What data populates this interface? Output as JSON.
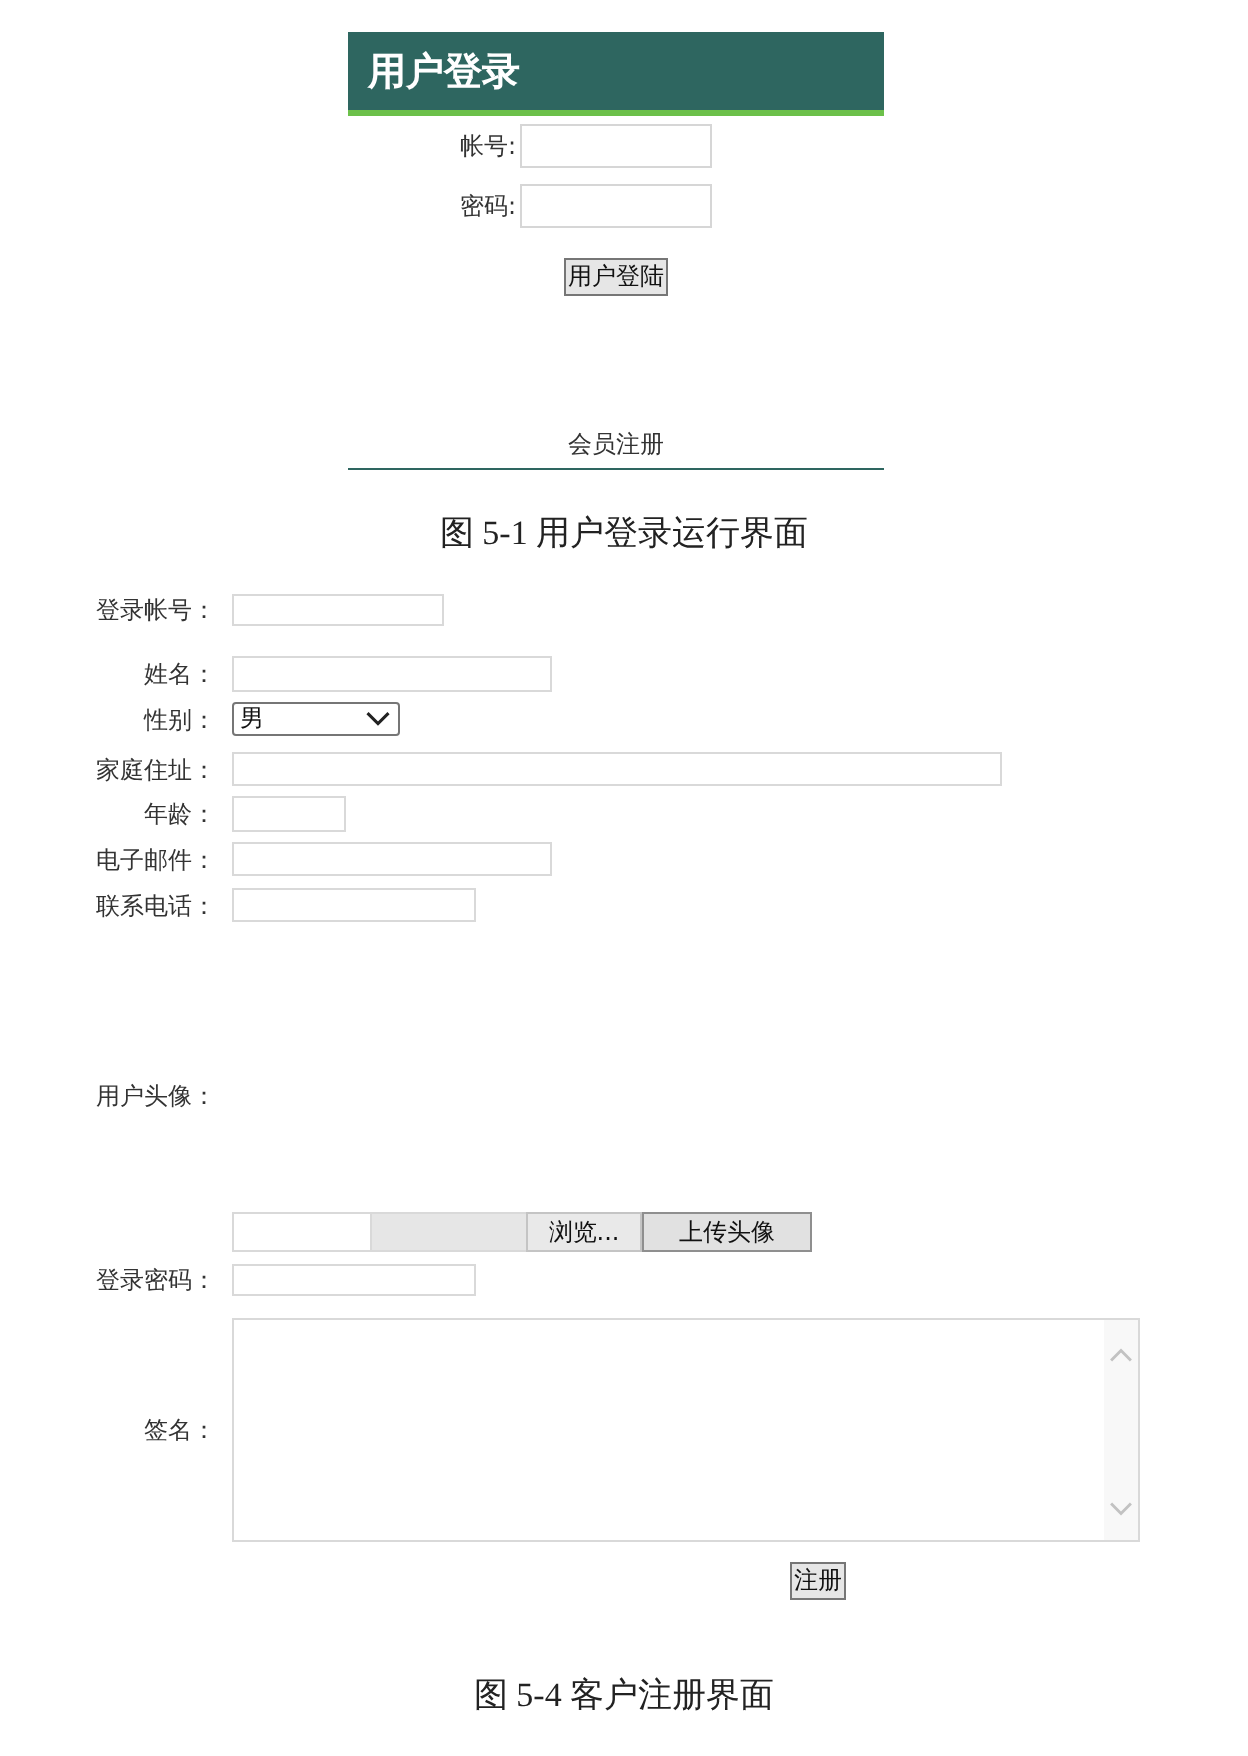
{
  "login_panel": {
    "title": "用户登录",
    "fields": [
      {
        "label": "帐号:"
      },
      {
        "label": "密码:"
      }
    ],
    "button": "用户登陆",
    "link": "会员注册"
  },
  "caption_top": "图 5-1 用户登录运行界面",
  "registration_form": {
    "rows": [
      {
        "kind": "text",
        "label": "登录帐号："
      },
      {
        "kind": "text",
        "label": "姓名："
      },
      {
        "kind": "select",
        "label": "性别：",
        "value": "男"
      },
      {
        "kind": "text",
        "label": "家庭住址："
      },
      {
        "kind": "text",
        "label": "年龄："
      },
      {
        "kind": "text",
        "label": "电子邮件："
      },
      {
        "kind": "text",
        "label": "联系电话："
      },
      {
        "kind": "avatar",
        "label": "用户头像："
      },
      {
        "kind": "file",
        "buttons": [
          "浏览...",
          "上传头像"
        ]
      },
      {
        "kind": "password",
        "label": "登录密码："
      },
      {
        "kind": "textarea",
        "label": "签名："
      }
    ],
    "submit": "注册"
  },
  "caption_bottom": "图 5-4 客户注册界面"
}
